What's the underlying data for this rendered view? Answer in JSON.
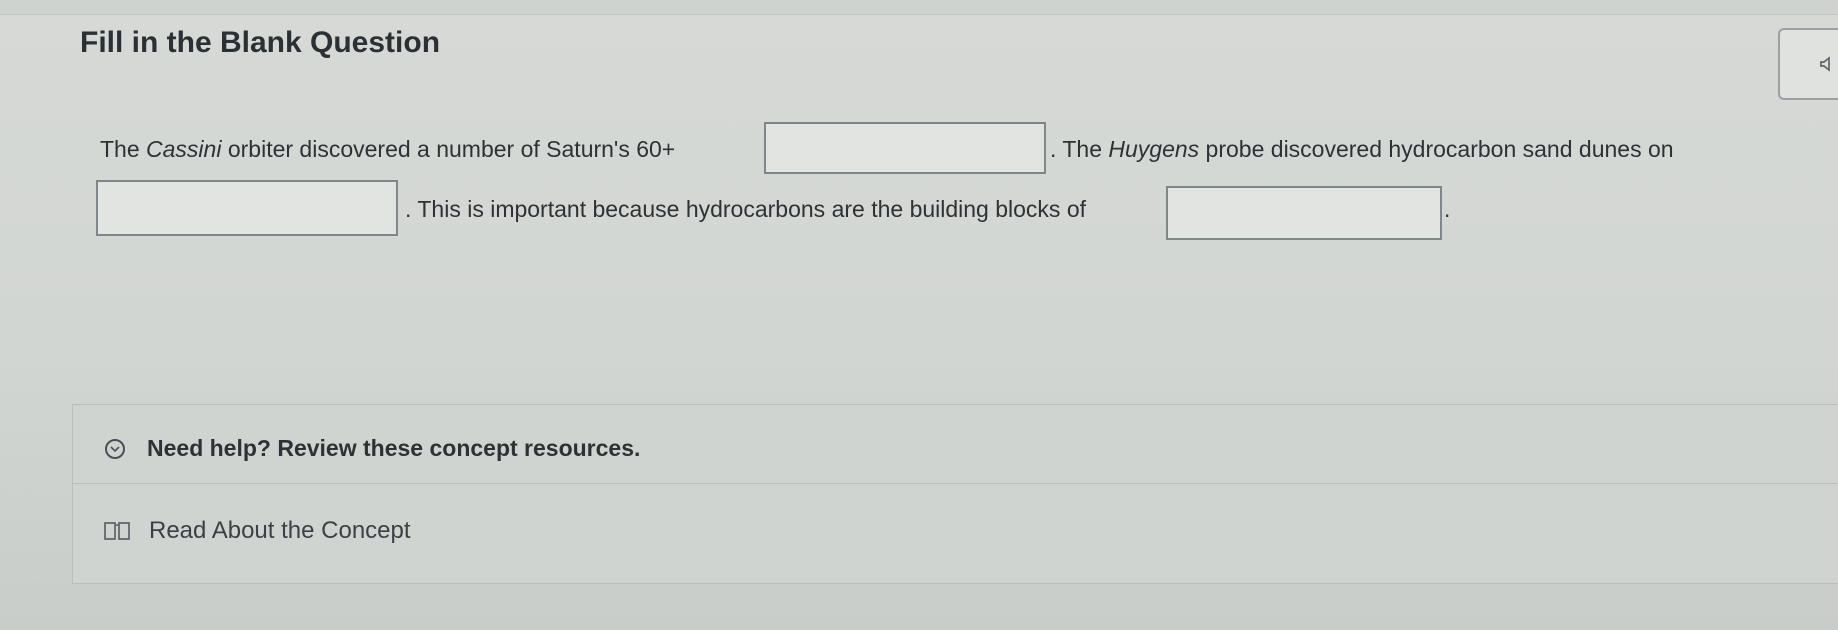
{
  "header": {
    "title": "Fill in the Blank Question",
    "audio_icon": "speaker-icon"
  },
  "question": {
    "line1_prefix": "The ",
    "line1_italic_1": "Cassini",
    "line1_middle": " orbiter discovered a number of Saturn's 60+",
    "line1_after_blank": ". The ",
    "line1_italic_2": "Huygens",
    "line1_suffix": " probe discovered hydrocarbon sand dunes on",
    "line2_text": ". This is important because hydrocarbons are the building blocks of",
    "line2_end": ".",
    "blanks": [
      {
        "value": ""
      },
      {
        "value": ""
      },
      {
        "value": ""
      }
    ]
  },
  "help": {
    "toggle_label": "Need help? Review these concept resources.",
    "toggle_icon": "chevron-down-circle-icon",
    "resource_label": "Read About the Concept",
    "resource_icon": "book-icon"
  }
}
